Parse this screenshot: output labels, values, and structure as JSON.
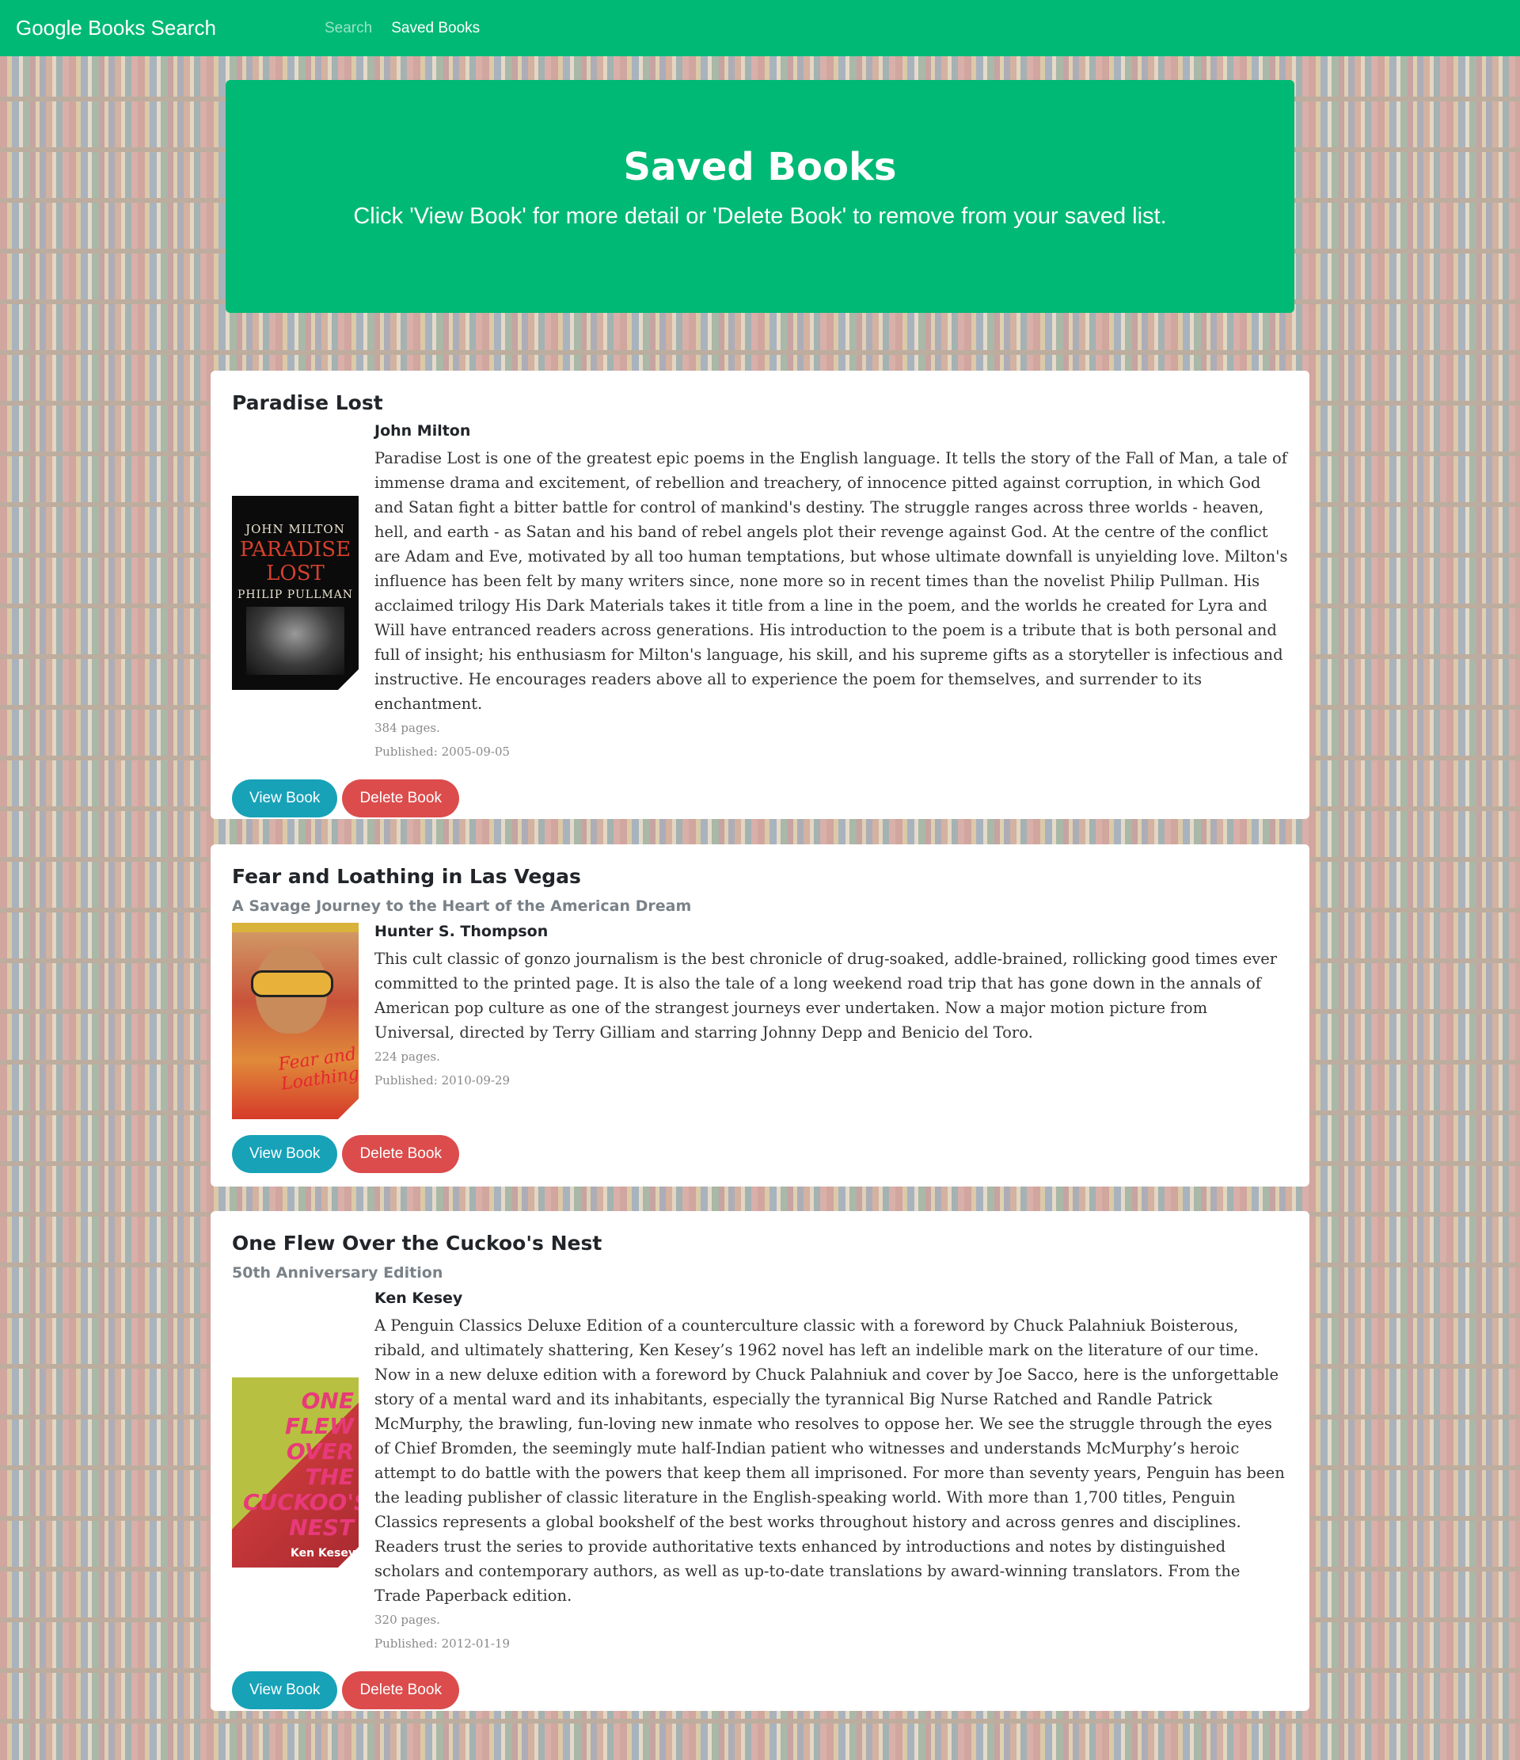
{
  "nav": {
    "brand": "Google Books Search",
    "links": [
      {
        "label": "Search"
      },
      {
        "label": "Saved Books"
      }
    ]
  },
  "header": {
    "title": "Saved Books",
    "subtitle": "Click 'View Book' for more detail or 'Delete Book' to remove from your saved list."
  },
  "buttons": {
    "view": "View Book",
    "delete": "Delete Book"
  },
  "books": [
    {
      "title": "Paradise Lost",
      "subtitle": "",
      "author": "John Milton",
      "description": "Paradise Lost is one of the greatest epic poems in the English language. It tells the story of the Fall of Man, a tale of immense drama and excitement, of rebellion and treachery, of innocence pitted against corruption, in which God and Satan fight a bitter battle for control of mankind's destiny. The struggle ranges across three worlds - heaven, hell, and earth - as Satan and his band of rebel angels plot their revenge against God. At the centre of the conflict are Adam and Eve, motivated by all too human temptations, but whose ultimate downfall is unyielding love. Milton's influence has been felt by many writers since, none more so in recent times than the novelist Philip Pullman. His acclaimed trilogy His Dark Materials takes it title from a line in the poem, and the worlds he created for Lyra and Will have entranced readers across generations. His introduction to the poem is a tribute that is both personal and full of insight; his enthusiasm for Milton's language, his skill, and his supreme gifts as a storyteller is infectious and instructive. He encourages readers above all to experience the poem for themselves, and surrender to its enchantment.",
      "pages": "384 pages.",
      "published": "Published: 2005-09-05",
      "cover": {
        "line1": "JOHN MILTON",
        "line2": "PARADISE",
        "line3": "LOST",
        "line4": "PHILIP PULLMAN"
      }
    },
    {
      "title": "Fear and Loathing in Las Vegas",
      "subtitle": "A Savage Journey to the Heart of the American Dream",
      "author": "Hunter S. Thompson",
      "description": "This cult classic of gonzo journalism is the best chronicle of drug-soaked, addle-brained, rollicking good times ever committed to the printed page. It is also the tale of a long weekend road trip that has gone down in the annals of American pop culture as one of the strangest journeys ever undertaken. Now a major motion picture from Universal, directed by Terry Gilliam and starring Johnny Depp and Benicio del Toro.",
      "pages": "224 pages.",
      "published": "Published: 2010-09-29",
      "cover": {
        "title": "Fear and Loathing"
      }
    },
    {
      "title": "One Flew Over the Cuckoo's Nest",
      "subtitle": "50th Anniversary Edition",
      "author": "Ken Kesey",
      "description": "A Penguin Classics Deluxe Edition of a counterculture classic with a foreword by Chuck Palahniuk Boisterous, ribald, and ultimately shattering, Ken Kesey’s 1962 novel has left an indelible mark on the literature of our time. Now in a new deluxe edition with a foreword by Chuck Palahniuk and cover by Joe Sacco, here is the unforgettable story of a mental ward and its inhabitants, especially the tyrannical Big Nurse Ratched and Randle Patrick McMurphy, the brawling, fun-loving new inmate who resolves to oppose her. We see the struggle through the eyes of Chief Bromden, the seemingly mute half-Indian patient who witnesses and understands McMurphy’s heroic attempt to do battle with the powers that keep them all imprisoned. For more than seventy years, Penguin has been the leading publisher of classic literature in the English-speaking world. With more than 1,700 titles, Penguin Classics represents a global bookshelf of the best works throughout history and across genres and disciplines. Readers trust the series to provide authoritative texts enhanced by introductions and notes by distinguished scholars and contemporary authors, as well as up-to-date translations by award-winning translators. From the Trade Paperback edition.",
      "pages": "320 pages.",
      "published": "Published: 2012-01-19",
      "cover": {
        "title": "ONE FLEW OVER THE CUCKOO'S NEST",
        "by": "Ken Kesey"
      }
    }
  ],
  "colors": {
    "brand_green": "#00b975",
    "view_button": "#17a2b8",
    "delete_button": "#dc4c4c"
  }
}
